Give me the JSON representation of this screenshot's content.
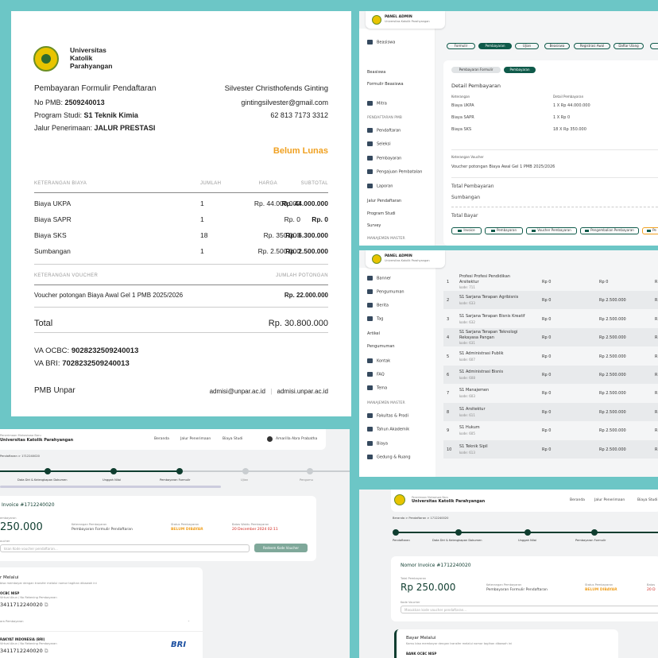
{
  "invoice": {
    "uni_name": [
      "Universitas",
      "Katolik",
      "Parahyangan"
    ],
    "title": "Pembayaran Formulir Pendaftaran",
    "pmb_label": "No PMB: ",
    "pmb": "2509240013",
    "prodi_label": "Program Studi: ",
    "prodi": "S1 Teknik Kimia",
    "jalur_label": "Jalur Penerimaan: ",
    "jalur": "JALUR PRESTASI",
    "name": "Silvester Christhofends Ginting",
    "email": "gintingsilvester@gmail.com",
    "phone": "62 813 7173 3312",
    "status": "Belum Lunas",
    "headers": [
      "KETERANGAN BIAYA",
      "JUMLAH",
      "HARGA",
      "SUBTOTAL"
    ],
    "items": [
      {
        "name": "Biaya UKPA",
        "qty": "1",
        "price": "Rp. 44.000.000",
        "sub": "Rp. 44.000.000"
      },
      {
        "name": "Biaya SAPR",
        "qty": "1",
        "price": "Rp. 0",
        "sub": "Rp. 0"
      },
      {
        "name": "Biaya SKS",
        "qty": "18",
        "price": "Rp. 350.000",
        "sub": "Rp. 6.300.000"
      },
      {
        "name": "Sumbangan",
        "qty": "1",
        "price": "Rp. 2.500.000",
        "sub": "Rp. 2.500.000"
      }
    ],
    "voucher_header": "KETERANGAN VOUCHER",
    "voucher_amount_header": "JUMLAH POTONGAN",
    "voucher_name": "Voucher potongan Biaya Awal Gel 1 PMB 2025/2026",
    "voucher_amount": "Rp. 22.000.000",
    "total_label": "Total",
    "total": "Rp. 30.800.000",
    "va1_label": "VA OCBC: ",
    "va1": "9028232509240013",
    "va2_label": "VA BRI: ",
    "va2": "7028232509240013",
    "footer": "PMB Unpar",
    "footer_email": "admisi@unpar.ac.id",
    "footer_sep": "|",
    "footer_site": "admisi.unpar.ac.id"
  },
  "admin1": {
    "brand": "PANEL ADMIN",
    "brand_sub": "Universitas Katolik Parahyangan",
    "side": [
      "Beasiswa",
      "Beasiswa",
      "Formulir Beasiswa",
      "Mitra",
      "PENDAFTARAN PMB",
      "Pendaftaran",
      "Seleksi",
      "Pembayaran",
      "Pengajuan Pembatalan",
      "Laporan",
      "Jalur Pendaftaran",
      "Program Studi",
      "Survey",
      "MANAJEMEN MASTER"
    ],
    "tabs": [
      "Formulir",
      "Pembayaran",
      "Ujian",
      "Beasiswa",
      "Registrasi Awal",
      "Daftar Ulang"
    ],
    "subtabs": [
      "Pembayaran Formulir",
      "Pembayaran"
    ],
    "detail_title": "Detail Pembayaran",
    "col1": "Keterangan",
    "col2": "Detail Pembayaran",
    "rows": [
      [
        "Biaya UKPA",
        "1 X Rp 44.000.000"
      ],
      [
        "Biaya SAPR",
        "1 X Rp 0"
      ],
      [
        "Biaya SKS",
        "18 X Rp 350.000"
      ]
    ],
    "voucher_label": "Keterangan Voucher",
    "voucher": "Voucher potongan Biaya Awal Gel 1 PMB 2025/2026",
    "total_pay": "Total Pembayaran",
    "sumbangan": "Sumbangan",
    "total_bayar": "Total Bayar",
    "buttons": [
      "Invoice",
      "Pembayaran",
      "Voucher Pembayaran",
      "Pengembalian Pembayaran",
      "Pe"
    ]
  },
  "admin2": {
    "side": [
      "Banner",
      "Pengumuman",
      "Berita",
      "Tag",
      "Artikel",
      "Pengumuman",
      "Kontak",
      "FAQ",
      "Tema",
      "MANAJEMEN MASTER",
      "Fakultas & Prodi",
      "Tahun Akademik",
      "Biaya",
      "Gedung & Ruang"
    ],
    "rows": [
      {
        "no": "1",
        "name": "Profesi Profesi Pendidikan",
        "name2": "Arsitektur",
        "kode": "kode: 711",
        "a": "Rp 0",
        "b": "Rp 0"
      },
      {
        "no": "2",
        "name": "S1 Sarjana Terapan Agribisnis",
        "kode": "kode: 633",
        "a": "Rp 0",
        "b": "Rp 2.500.000"
      },
      {
        "no": "3",
        "name": "S1 Sarjana Terapan Bisnis Kreatif",
        "kode": "kode: 632",
        "a": "Rp 0",
        "b": "Rp 2.500.000"
      },
      {
        "no": "4",
        "name": "S1 Sarjana Terapan Teknologi",
        "name2": "Rekayasa Pangan",
        "kode": "kode: 631",
        "a": "Rp 0",
        "b": "Rp 2.500.000"
      },
      {
        "no": "5",
        "name": "S1 Administrasi Publik",
        "kode": "kode: 607",
        "a": "Rp 0",
        "b": "Rp 2.500.000"
      },
      {
        "no": "6",
        "name": "S1 Administrasi Bisnis",
        "kode": "kode: 608",
        "a": "Rp 0",
        "b": "Rp 2.500.000"
      },
      {
        "no": "7",
        "name": "S1 Manajemen",
        "kode": "kode: 603",
        "a": "Rp 0",
        "b": "Rp 2.500.000"
      },
      {
        "no": "8",
        "name": "S1 Arsitektur",
        "kode": "kode: 611",
        "a": "Rp 0",
        "b": "Rp 2.500.000"
      },
      {
        "no": "9",
        "name": "S1 Hukum",
        "kode": "kode: 605",
        "a": "Rp 0",
        "b": "Rp 2.500.000"
      },
      {
        "no": "10",
        "name": "S1 Teknik Sipil",
        "kode": "kode: 613",
        "a": "Rp 0",
        "b": "Rp 2.500.000"
      }
    ],
    "r_letter": "R"
  },
  "user1": {
    "brand_small": "Penerimaan Mahasiswa Baru",
    "brand": "Universitas Katolik Parahyangan",
    "nav": [
      "Beranda",
      "Jalur Penerimaan",
      "Biaya Studi"
    ],
    "user": "Amarilla Abra Prabatha",
    "crumb": "Pendaftaran  >  1712240020",
    "steps": [
      "Data Diri & Kelengkapan Dokumen",
      "Unggah Nilai",
      "Pembayaran Formulir",
      "Ujian",
      "Pengumu"
    ],
    "invoice_title": "Invoice #1712240020",
    "total_label": "embayaran",
    "amount": "250.000",
    "ket_label": "Keterangan Pembayaran",
    "ket": "Pembayaran Formulir Pendaftaran",
    "status_label": "Status Pembayaran",
    "status": "BELUM DIBAYAR",
    "deadline_label": "Batas Waktu Pembayaran",
    "deadline": "20 December 2024 02:11",
    "voucher_label": "oucher",
    "voucher_ph": "kkan Kode voucher pendaftaran...",
    "redeem": "Redeem Kode Voucher",
    "pay_title": "r Melalui",
    "pay_sub": "bisa membayar dengan transfer melalui nomor tagihan dibawah ini",
    "bank1": "OCBC NISP",
    "va_label": "Virtual Akun / No Rekening Pembayaran",
    "va1": "3411712240020",
    "collapse": "ara Pembayaran",
    "bank2": "RAKYAT INDONESIA (BRI)",
    "va2": "3411712240020",
    "bri": "BRI"
  },
  "user2": {
    "brand_small": "Penerimaan Mahasiswa Baru",
    "brand": "Universitas Katolik Parahyangan",
    "nav": [
      "Beranda",
      "Jalur Penerimaan",
      "Biaya Studi"
    ],
    "crumb": "Beranda  >  Pendaftaran  >  1712240020",
    "steps": [
      "Pendaftaran",
      "Data Diri & Kelengkapan Dokumen",
      "Unggah Nilai",
      "Pembayaran Formulir"
    ],
    "invoice_title": "Nomor Invoice #1712240020",
    "total_label": "Total Pembayaran",
    "amount": "Rp 250.000",
    "ket_label": "Keterangan Pembayaran",
    "ket": "Pembayaran Formulir Pendaftaran",
    "status_label": "Status Pembayaran",
    "status": "BELUM DIBAYAR",
    "deadline_label": "Batas",
    "deadline": "20 D",
    "voucher_label": "Kode Voucher",
    "voucher_ph": "Masukkan kode voucher pendaftaran...",
    "pay_title": "Bayar Melalui",
    "pay_sub": "Kamu bisa membayar dengan transfer melalui nomor tagihan dibawah ini",
    "bank1": "BANK OCBC NISP"
  }
}
